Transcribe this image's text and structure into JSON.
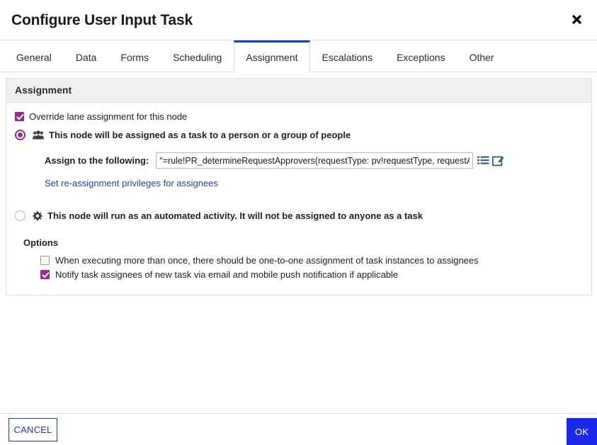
{
  "dialog": {
    "title": "Configure User Input Task",
    "close_icon": "close-icon"
  },
  "tabs": [
    {
      "label": "General",
      "active": false
    },
    {
      "label": "Data",
      "active": false
    },
    {
      "label": "Forms",
      "active": false
    },
    {
      "label": "Scheduling",
      "active": false
    },
    {
      "label": "Assignment",
      "active": true
    },
    {
      "label": "Escalations",
      "active": false
    },
    {
      "label": "Exceptions",
      "active": false
    },
    {
      "label": "Other",
      "active": false
    }
  ],
  "panel": {
    "header": "Assignment",
    "override": {
      "label": "Override lane assignment for this node",
      "checked": true
    },
    "assignment_mode": {
      "person_option": {
        "label": "This node will be assigned as a task to a person or a group of people",
        "icon": "people-group-icon",
        "selected": true
      },
      "automated_option": {
        "label": "This node will run as an automated activity. It will not be assigned to anyone as a task",
        "icon": "gear-icon",
        "selected": false
      }
    },
    "assign_to": {
      "label": "Assign to the following:",
      "value": "\"=rule!PR_determineRequestApprovers(requestType: pv!requestType, requestA",
      "placeholder": "",
      "list_icon": "list-picker-icon",
      "edit_icon": "edit-expression-icon"
    },
    "reassignment_link": "Set re-assignment privileges for assignees",
    "options": {
      "title": "Options",
      "items": [
        {
          "label": "When executing more than once, there should be one-to-one assignment of task instances to assignees",
          "checked": false
        },
        {
          "label": "Notify task assignees of new task via email and mobile push notification if applicable",
          "checked": true
        }
      ]
    }
  },
  "footer": {
    "cancel_label": "CANCEL",
    "ok_label": "OK"
  },
  "colors": {
    "accent_blue": "#1836e8",
    "checkbox_purple": "#9b288f",
    "link_blue": "#2b38d4",
    "panel_header_gray": "#efefef"
  }
}
